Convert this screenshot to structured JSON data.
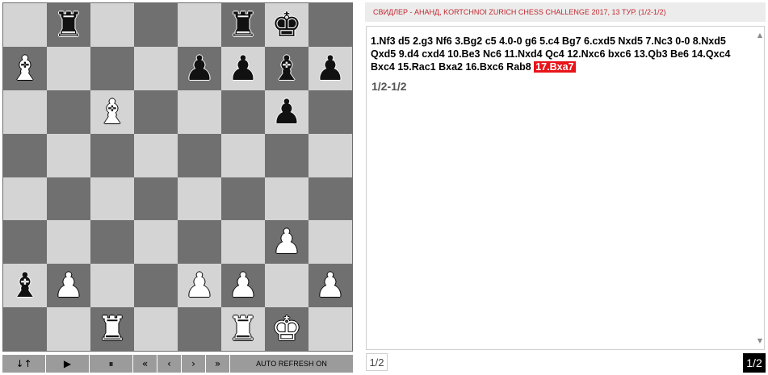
{
  "board": {
    "squares": [
      [
        "",
        "bR",
        "",
        "",
        "",
        "bR",
        "bK",
        ""
      ],
      [
        "wB",
        "",
        "",
        "",
        "bP",
        "bP",
        "bB",
        "bP"
      ],
      [
        "",
        "",
        "wB",
        "",
        "",
        "",
        "bP",
        ""
      ],
      [
        "",
        "",
        "",
        "",
        "",
        "",
        "",
        ""
      ],
      [
        "",
        "",
        "",
        "",
        "",
        "",
        "",
        ""
      ],
      [
        "",
        "",
        "",
        "",
        "",
        "",
        "wP",
        ""
      ],
      [
        "bB",
        "wP",
        "",
        "",
        "wP",
        "wP",
        "",
        "wP"
      ],
      [
        "",
        "",
        "wR",
        "",
        "",
        "wR",
        "wK",
        ""
      ]
    ]
  },
  "controls": {
    "flip": "↓↑",
    "play": "▶",
    "pause": "⏸",
    "first": "«",
    "prev": "‹",
    "next": "›",
    "last": "»",
    "auto_refresh": "AUTO REFRESH ON"
  },
  "game": {
    "title": "СВИДЛЕР - АНАНД, KORTCHNOI ZURICH CHESS CHALLENGE 2017, 13 ТУР. (1/2-1/2)",
    "moves_line": "1.Nf3 d5 2.g3 Nf6 3.Bg2 c5 4.0-0 g6 5.c4 Bg7 6.cxd5 Nxd5 7.Nc3 0-0 8.Nxd5 Qxd5 9.d4 cxd4 10.Be3 Nc6 11.Nxd4 Qc4 12.Nxc6 bxc6 13.Qb3 Be6 14.Qxc4 Bxc4 15.Rac1 Bxa2 16.Bxc6 Rab8",
    "current_move": "17.Bxa7",
    "result": "1/2-1/2"
  },
  "scrollbar": {
    "up": "▲",
    "down": "▼"
  },
  "footer": {
    "page_indicator": "1/2",
    "page_badge": "1/2"
  }
}
